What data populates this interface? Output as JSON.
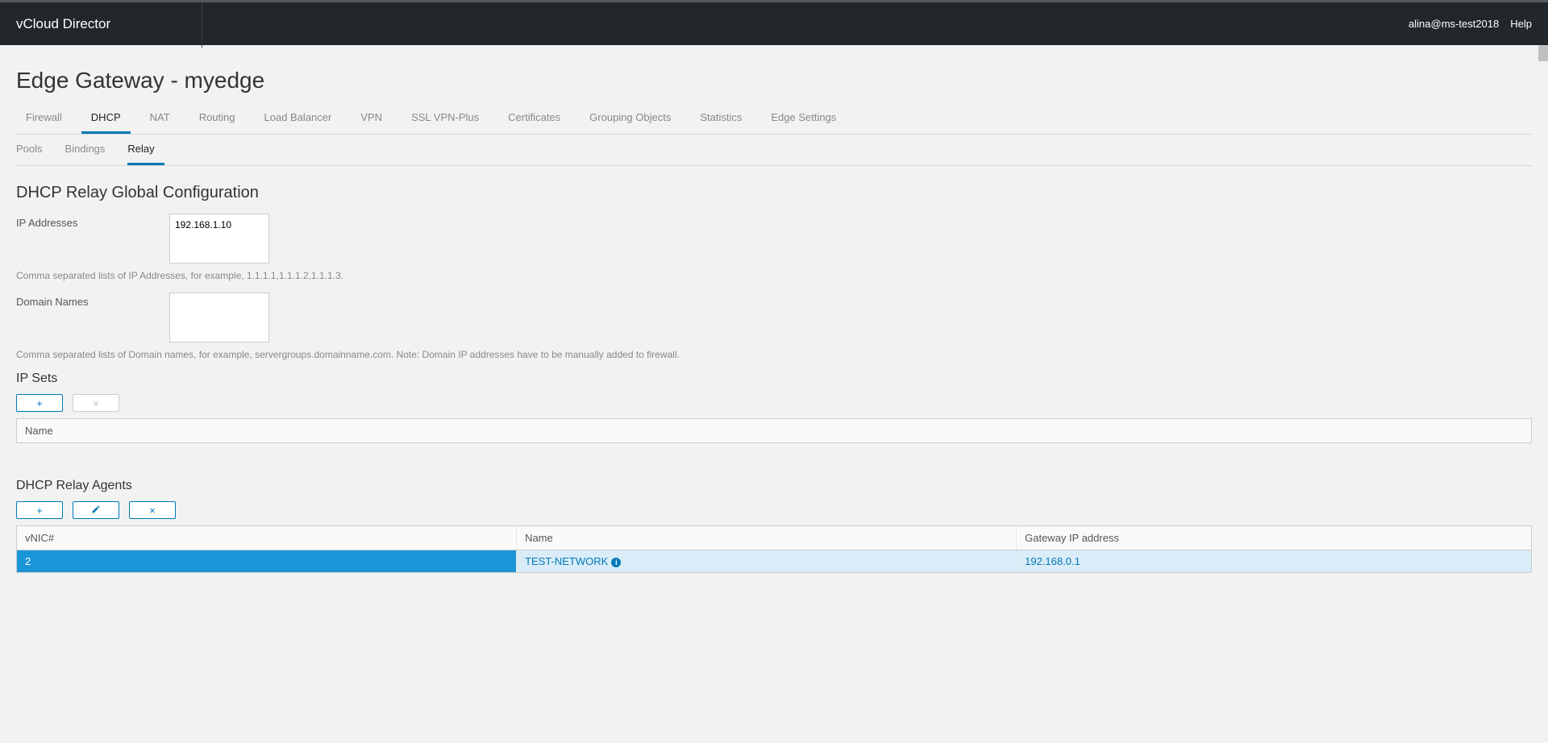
{
  "header": {
    "brand": "vCloud Director",
    "user": "alina@ms-test2018",
    "help": "Help"
  },
  "page": {
    "title": "Edge Gateway - myedge"
  },
  "tabs": {
    "items": [
      "Firewall",
      "DHCP",
      "NAT",
      "Routing",
      "Load Balancer",
      "VPN",
      "SSL VPN-Plus",
      "Certificates",
      "Grouping Objects",
      "Statistics",
      "Edge Settings"
    ],
    "active": "DHCP"
  },
  "subtabs": {
    "items": [
      "Pools",
      "Bindings",
      "Relay"
    ],
    "active": "Relay"
  },
  "relay": {
    "section_title": "DHCP Relay Global Configuration",
    "ip_label": "IP Addresses",
    "ip_value": "192.168.1.10",
    "ip_hint": "Comma separated lists of IP Addresses, for example, 1.1.1.1,1.1.1.2,1.1.1.3.",
    "domain_label": "Domain Names",
    "domain_value": "",
    "domain_hint": "Comma separated lists of Domain names, for example, servergroups.domainname.com. Note: Domain IP addresses have to be manually added to firewall."
  },
  "ipsets": {
    "title": "IP Sets",
    "col_name": "Name",
    "rows": []
  },
  "agents": {
    "title": "DHCP Relay Agents",
    "cols": {
      "vnic": "vNIC#",
      "name": "Name",
      "gateway": "Gateway IP address"
    },
    "rows": [
      {
        "vnic": "2",
        "name": "TEST-NETWORK",
        "gateway": "192.168.0.1"
      }
    ]
  }
}
